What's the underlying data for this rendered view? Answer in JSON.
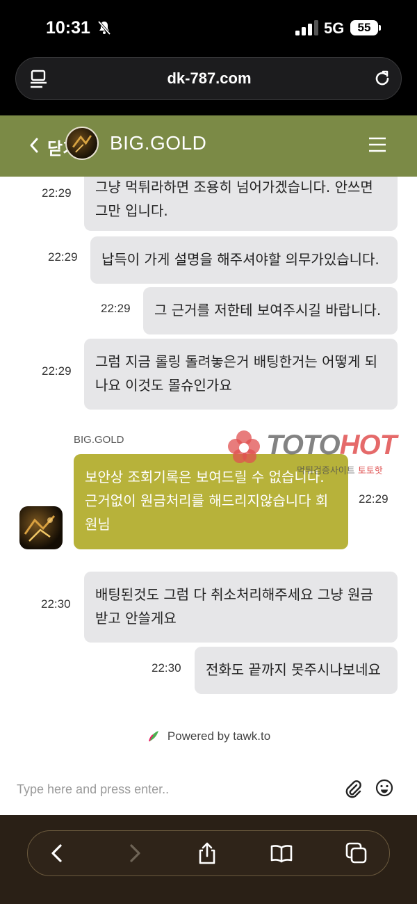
{
  "status_bar": {
    "time": "10:31",
    "network": "5G",
    "battery": "55"
  },
  "browser": {
    "url": "dk-787.com"
  },
  "header": {
    "close_label": "닫기",
    "title": "BIG.GOLD"
  },
  "messages": [
    {
      "from": "visitor",
      "time": "22:29",
      "lines": [
        "그냥 먹튀라하면 조용히 넘어가겠습니다. 안쓰면",
        "그만 입니다."
      ]
    },
    {
      "from": "visitor",
      "time": "22:29",
      "lines": [
        "납득이 가게 설명을 해주셔야할 의무가있습니다."
      ]
    },
    {
      "from": "visitor",
      "time": "22:29",
      "lines": [
        "그 근거를 저한테 보여주시길 바랍니다."
      ]
    },
    {
      "from": "visitor",
      "time": "22:29",
      "lines": [
        "그럼 지금 롤링 돌려놓은거 배팅한거는 어떻게 되",
        "나요 이것도 몰슈인가요"
      ]
    },
    {
      "from": "agent",
      "sender": "BIG.GOLD",
      "time": "22:29",
      "lines": [
        "보안상 조회기록은 보여드릴 수 없습니다.",
        "근거없이 원금처리를 해드리지않습니다 회",
        "원님"
      ]
    },
    {
      "from": "visitor",
      "time": "22:30",
      "lines": [
        "배팅된것도 그럼 다 취소처리해주세요 그냥 원금",
        "받고 안쓸게요"
      ]
    },
    {
      "from": "visitor",
      "time": "22:30",
      "lines": [
        "전화도 끝까지 못주시나보네요"
      ]
    }
  ],
  "watermark": {
    "brand_a": "TOTO",
    "brand_b": "HOT",
    "sub_a": "먹튀검증사이트",
    "sub_b": "토토핫"
  },
  "powered_by": "Powered by tawk.to",
  "composer": {
    "placeholder": "Type here and press enter.."
  },
  "colors": {
    "header": "#7b8a46",
    "agent_bubble": "#b7b23a",
    "visitor_bubble": "#e6e6e8",
    "toolbar": "#2a2016"
  },
  "icons": [
    "bell-mute-icon",
    "signal-icon",
    "reader-icon",
    "reload-icon",
    "back-chevron-icon",
    "menu-icon",
    "paperclip-icon",
    "emoji-icon",
    "browser-back-icon",
    "browser-forward-icon",
    "share-icon",
    "bookmarks-icon",
    "tabs-icon"
  ]
}
